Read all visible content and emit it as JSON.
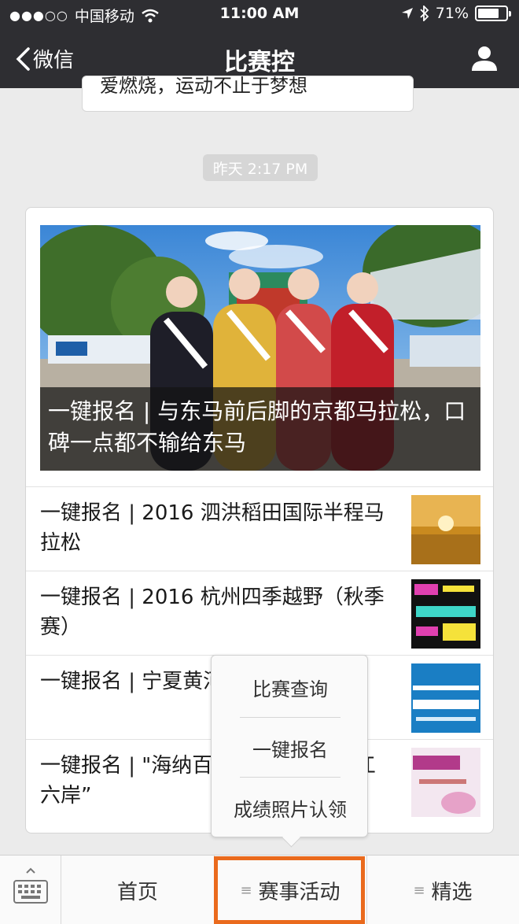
{
  "status_bar": {
    "carrier": "中国移动",
    "time": "11:00 AM",
    "battery": "71%"
  },
  "nav": {
    "back_label": "微信",
    "title": "比赛控"
  },
  "prev_message_fragment": "爱燃烧，运动不止于梦想",
  "timestamp": "昨天 2:17 PM",
  "article": {
    "hero_title": "一键报名 | 与东马前后脚的京都马拉松，口碑一点都不输给东马",
    "items": [
      {
        "title": "一键报名 | 2016 泗洪稻田国际半程马拉松",
        "thumb": "golden-rice-field-thumbnail"
      },
      {
        "title": "一键报名 | 2016 杭州四季越野（秋季赛）",
        "thumb": "trailrunning-neon-thumbnail"
      },
      {
        "title": "一键报名 | 宁夏黄河金岸国际马拉松",
        "thumb": "yellow-river-marathon-thumbnail"
      },
      {
        "title": "一键报名 | \"海纳百川\"首届韶关“三江六岸”",
        "thumb": "jiayou-poster-thumbnail"
      }
    ]
  },
  "popup_menu": {
    "items": [
      "比赛查询",
      "一键报名",
      "成绩照片认领"
    ]
  },
  "tabbar": {
    "home": "首页",
    "events": "赛事活动",
    "featured": "精选",
    "highlight_color": "#ea6a1d"
  }
}
